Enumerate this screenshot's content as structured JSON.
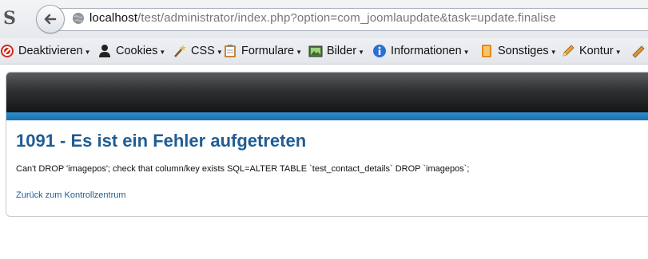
{
  "browser": {
    "logo_letter": "S",
    "url_host": "localhost",
    "url_path": "/test/administrator/index.php?option=com_joomlaupdate&task=update.finalise"
  },
  "toolbar": {
    "items": [
      {
        "label": "Deaktivieren",
        "icon": "disable-icon"
      },
      {
        "label": "Cookies",
        "icon": "cookies-icon"
      },
      {
        "label": "CSS",
        "icon": "css-wand-icon"
      },
      {
        "label": "Formulare",
        "icon": "forms-icon"
      },
      {
        "label": "Bilder",
        "icon": "images-icon"
      },
      {
        "label": "Informationen",
        "icon": "info-icon"
      },
      {
        "label": "Sonstiges",
        "icon": "misc-icon"
      },
      {
        "label": "Kontur",
        "icon": "pencil-icon"
      }
    ]
  },
  "error": {
    "title": "1091 - Es ist ein Fehler aufgetreten",
    "message": "Can't DROP 'imagepos'; check that column/key exists SQL=ALTER TABLE `test_contact_details` DROP `imagepos`;",
    "back_link": "Zurück zum Kontrollzentrum"
  },
  "colors": {
    "title": "#1f5d93",
    "accent_strip": "#2d8fd0",
    "header": "#2f3133"
  }
}
